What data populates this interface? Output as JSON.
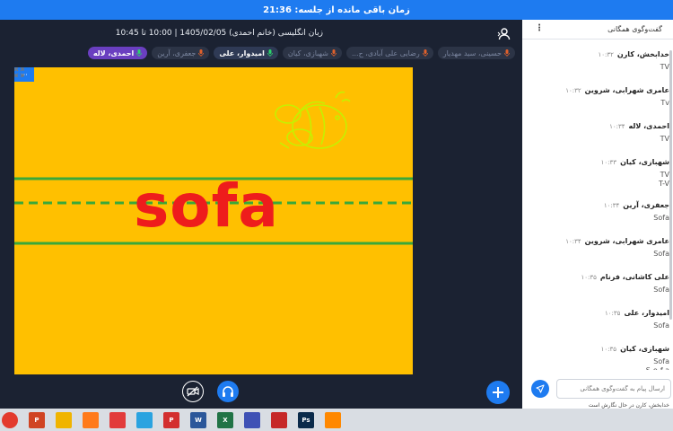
{
  "topbar": {
    "time_remaining": "زمان باقی مانده از جلسه: 21:36"
  },
  "session": {
    "title": "زبان انگلیسی (خانم احمدی) 1405/02/05 | 10:00 تا 10:45"
  },
  "participants": [
    {
      "name": "حسینی، سید مهدیار",
      "state": "off"
    },
    {
      "name": "رضایی علی آبادی، ح...",
      "state": "off"
    },
    {
      "name": "شهبازی، کیان",
      "state": "off"
    },
    {
      "name": "امیدوار، علی",
      "state": "on"
    },
    {
      "name": "جعفری، آرین",
      "state": "off"
    },
    {
      "name": "احمدی، لاله",
      "state": "host"
    }
  ],
  "board": {
    "word": "sofa",
    "menu_glyph": "···"
  },
  "chat": {
    "title": "گفت‌وگوی همگانی",
    "input_placeholder": "ارسال پیام به گفت‌وگوی همگانی",
    "typing_notice": "خدابخش، کارن در حال نگارش است",
    "messages": [
      {
        "name": "خدابخش، کارن",
        "time": "۱۰:۳۲",
        "text": "TV"
      },
      {
        "name": "عامری شهرابی، شروین",
        "time": "۱۰:۳۲",
        "text": "Tv"
      },
      {
        "name": "احمدی، لاله",
        "time": "۱۰:۳۴",
        "text": "TV"
      },
      {
        "name": "شهبازی، کیان",
        "time": "۱۰:۳۳",
        "text": "TV\nT-V"
      },
      {
        "name": "جعفری، آرین",
        "time": "۱۰:۳۴",
        "text": "Sofa"
      },
      {
        "name": "عامری شهرابی، شروین",
        "time": "۱۰:۳۴",
        "text": "Sofa"
      },
      {
        "name": "علی کاشانی، فرنام",
        "time": "۱۰:۳۵",
        "text": "Sofa"
      },
      {
        "name": "امیدوار، علی",
        "time": "۱۰:۳۵",
        "text": "Sofa"
      },
      {
        "name": "شهبازی، کیان",
        "time": "۱۰:۳۵",
        "text": "Sofa\nS-o-f-a"
      }
    ]
  },
  "taskbar": {
    "apps": [
      {
        "name": "chrome-icon",
        "color": "#e33b2e"
      },
      {
        "name": "powerpoint-icon",
        "color": "#d04423",
        "glyph": "P"
      },
      {
        "name": "file-explorer-icon",
        "color": "#f0b400"
      },
      {
        "name": "firefox-icon",
        "color": "#ff7a1a"
      },
      {
        "name": "anydesk-icon",
        "color": "#e23b3b"
      },
      {
        "name": "telegram-icon",
        "color": "#2aa3e0"
      },
      {
        "name": "pdf-reader-icon",
        "color": "#d32f2f",
        "glyph": "P"
      },
      {
        "name": "word-icon",
        "color": "#2b579a",
        "glyph": "W"
      },
      {
        "name": "excel-icon",
        "color": "#217346",
        "glyph": "X"
      },
      {
        "name": "app-icon",
        "color": "#3f51b5"
      },
      {
        "name": "acrobat-icon",
        "color": "#c62828"
      },
      {
        "name": "photoshop-icon",
        "color": "#0b2a4a",
        "glyph": "Ps"
      },
      {
        "name": "vlc-icon",
        "color": "#ff8800"
      }
    ]
  }
}
